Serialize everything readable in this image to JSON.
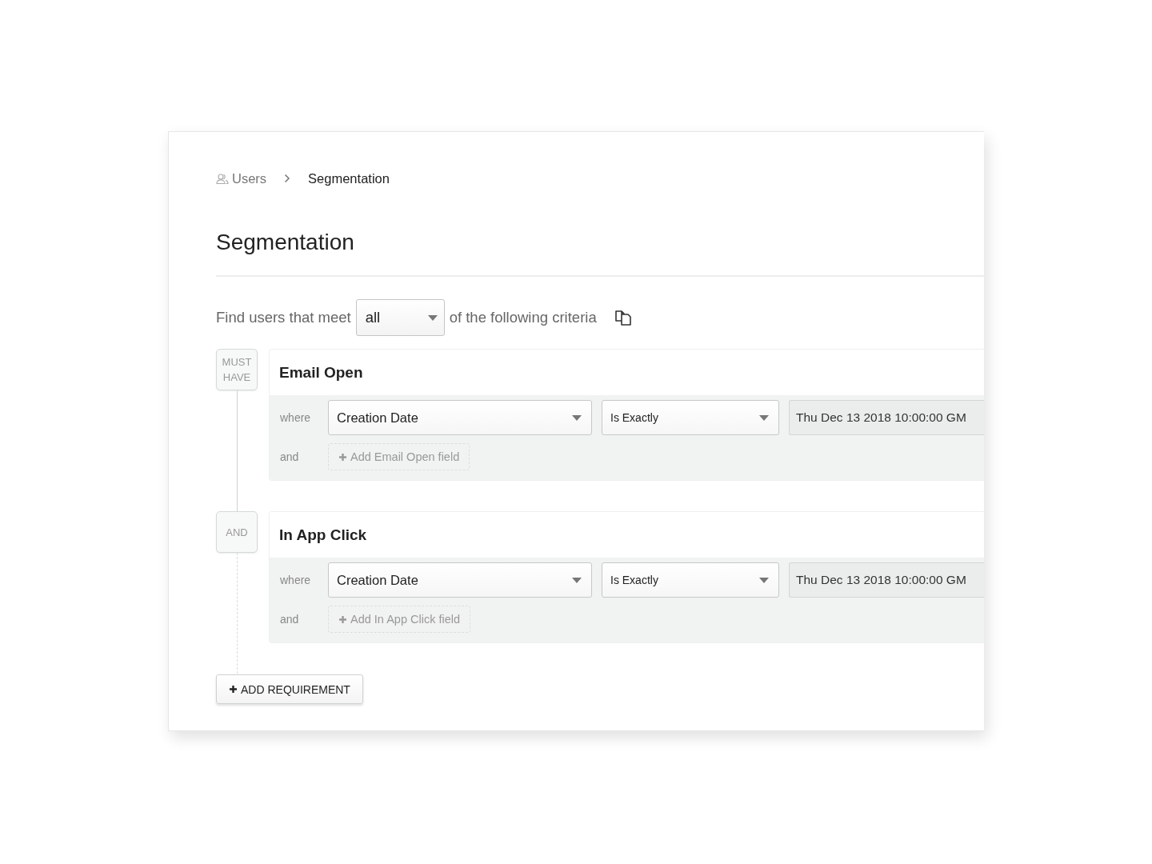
{
  "breadcrumb": [
    {
      "label": "Users",
      "kind": "link"
    },
    {
      "label": "Segmentation",
      "kind": "current"
    }
  ],
  "title": "Segmentation",
  "criteria": {
    "prefix": "Find users that meet",
    "match": "all",
    "suffix": "of the following criteria"
  },
  "requirements": [
    {
      "connector": "MUST HAVE",
      "event": "Email Open",
      "where_label": "where",
      "field": "Creation Date",
      "operator": "Is Exactly",
      "value": "Thu Dec 13 2018 10:00:00 GM",
      "and_label": "and",
      "add_field": "Add Email Open field"
    },
    {
      "connector": "AND",
      "event": "In App Click",
      "where_label": "where",
      "field": "Creation Date",
      "operator": "Is Exactly",
      "value": "Thu Dec 13 2018 10:00:00 GM",
      "and_label": "and",
      "add_field": "Add In App Click field"
    }
  ],
  "add_requirement": "ADD REQUIREMENT"
}
